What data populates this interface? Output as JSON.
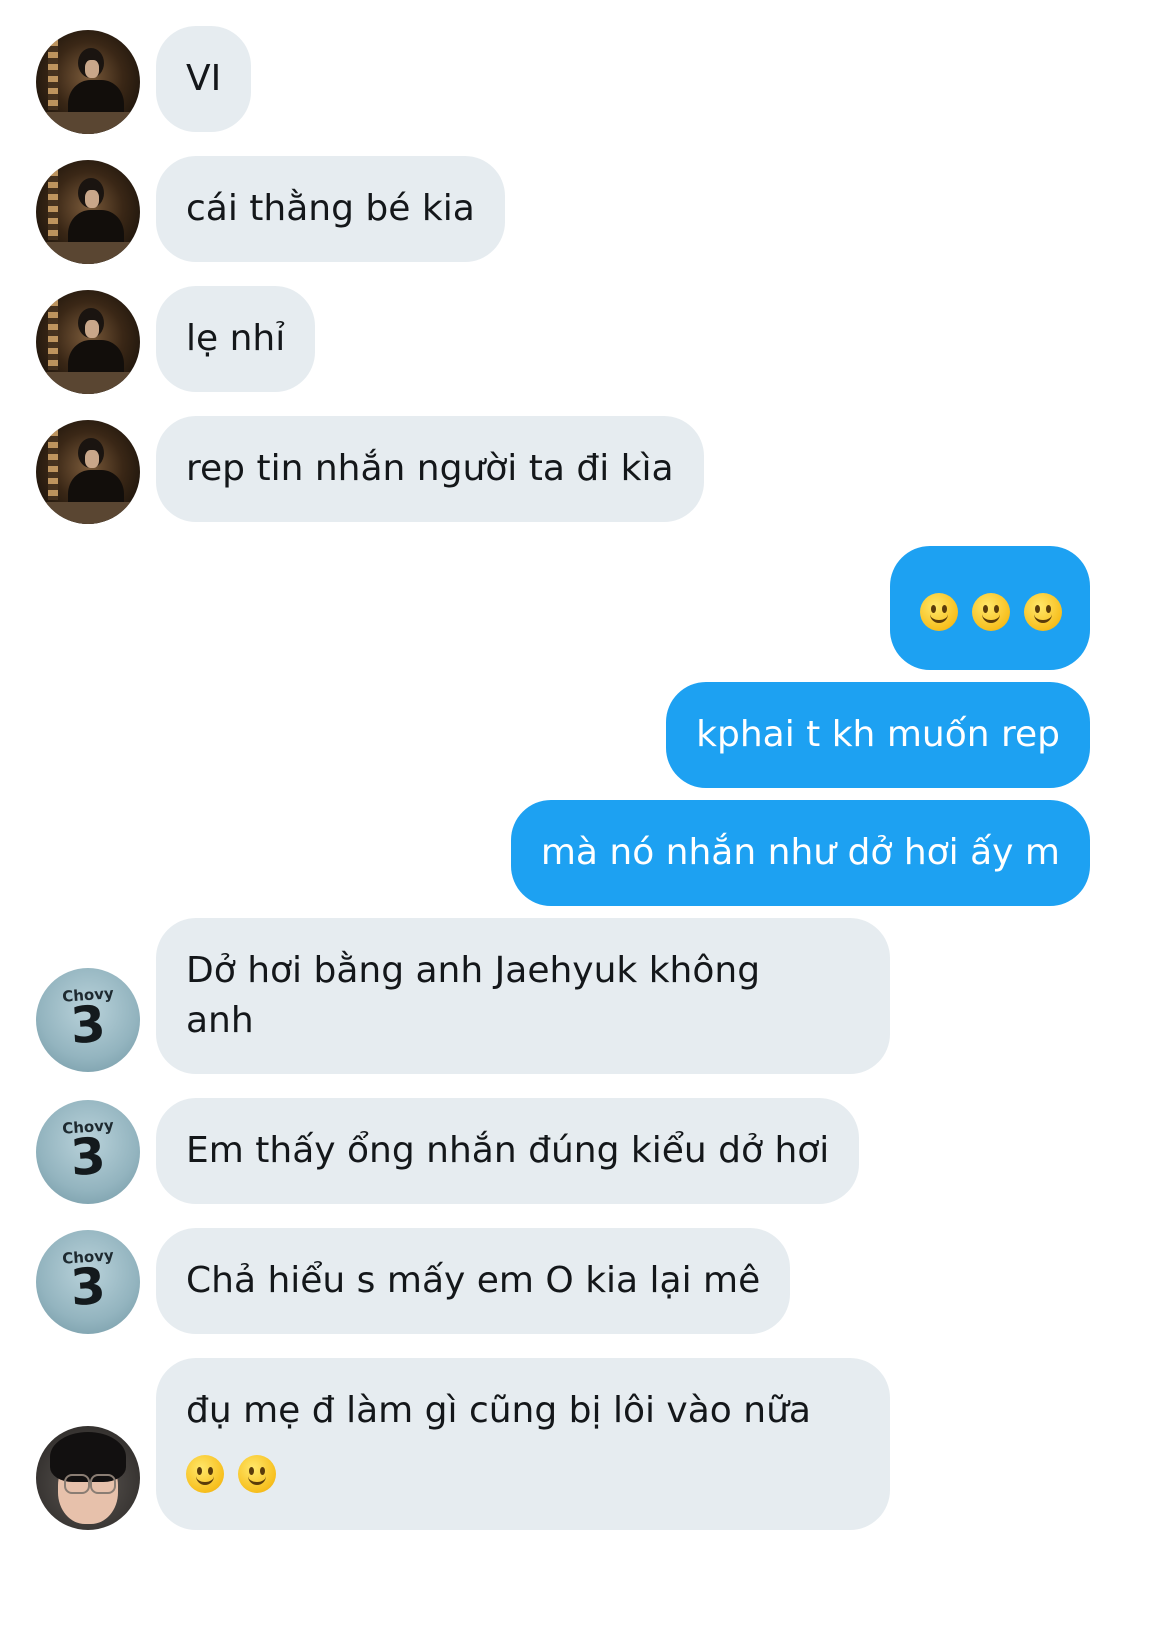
{
  "messages": [
    {
      "side": "in",
      "sender": "dark",
      "text": "VI"
    },
    {
      "side": "in",
      "sender": "dark",
      "text": "cái thằng bé kia"
    },
    {
      "side": "in",
      "sender": "dark",
      "text": "lẹ nhỉ"
    },
    {
      "side": "in",
      "sender": "dark",
      "text": "rep tin nhắn người ta đi kìa"
    },
    {
      "side": "out",
      "text": "",
      "emoji_count": 3
    },
    {
      "side": "out",
      "text": "kphai t kh muốn rep"
    },
    {
      "side": "out",
      "text": "mà nó nhắn như dở hơi ấy m"
    },
    {
      "side": "in",
      "sender": "jersey",
      "text_line1": "Dở hơi bằng anh Jaehyuk không",
      "text_line2": "anh"
    },
    {
      "side": "in",
      "sender": "jersey",
      "text": "Em thấy ổng nhắn đúng kiểu dở hơi"
    },
    {
      "side": "in",
      "sender": "jersey",
      "text": "Chả hiểu s mấy em O kia lại mê"
    },
    {
      "side": "in",
      "sender": "person",
      "text": "đụ mẹ đ làm gì cũng bị lôi vào nữa",
      "emoji_count": 2
    }
  ],
  "jersey": {
    "name": "Chovy",
    "number": "3"
  },
  "icons": {
    "emoji": "slightly-smiling-face-icon"
  },
  "colors": {
    "incoming_bubble": "#e6ecf0",
    "outgoing_bubble": "#1da1f2"
  }
}
